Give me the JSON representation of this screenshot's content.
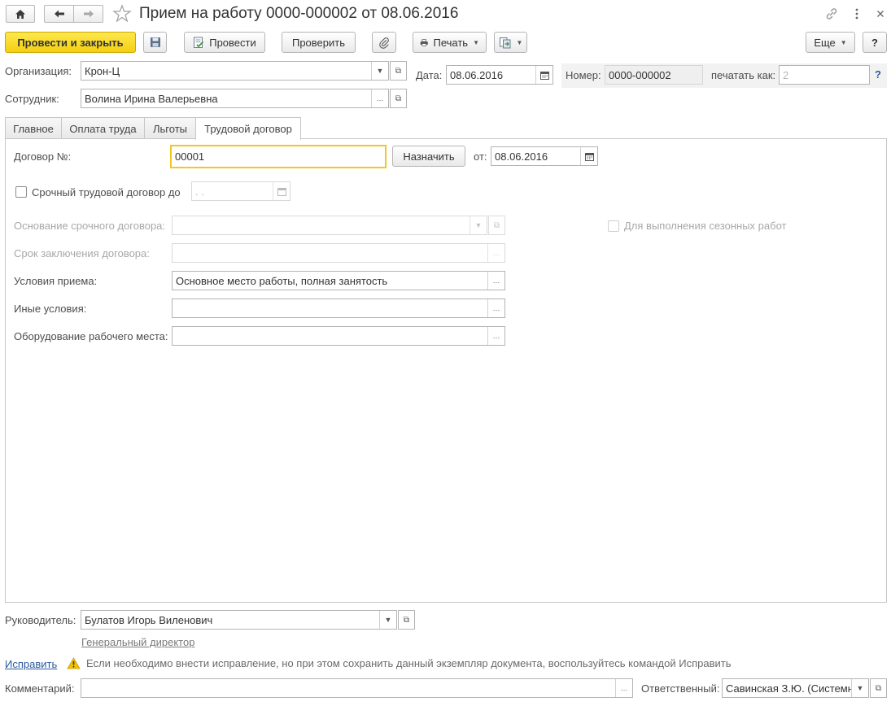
{
  "window": {
    "title": "Прием на работу 0000-000002 от 08.06.2016",
    "icons": [
      "home-icon",
      "back-arrow-icon",
      "forward-arrow-icon",
      "star-icon",
      "link-icon",
      "more-vertical-icon",
      "close-icon"
    ]
  },
  "toolbar": {
    "post_and_close": "Провести и закрыть",
    "post": "Провести",
    "check": "Проверить",
    "print": "Печать",
    "more": "Еще",
    "help": "?"
  },
  "header": {
    "organization_label": "Организация:",
    "organization_value": "Крон-Ц",
    "date_label": "Дата:",
    "date_value": "08.06.2016",
    "number_label": "Номер:",
    "number_value": "0000-000002",
    "print_as_label": "печатать как:",
    "print_as_placeholder": "2",
    "help_mark": "?",
    "employee_label": "Сотрудник:",
    "employee_value": "Волина Ирина Валерьевна"
  },
  "tabs": [
    {
      "label": "Главное",
      "active": false
    },
    {
      "label": "Оплата труда",
      "active": false
    },
    {
      "label": "Льготы",
      "active": false
    },
    {
      "label": "Трудовой договор",
      "active": true
    }
  ],
  "contract": {
    "number_label": "Договор №:",
    "number_value": "00001",
    "assign_button": "Назначить",
    "from_label": "от:",
    "from_date": "08.06.2016",
    "fixed_term_label": "Срочный трудовой договор до",
    "fixed_term_date": " .  .",
    "fixed_term_checked": false,
    "basis_label": "Основание срочного договора:",
    "basis_value": "",
    "seasonal_label": "Для выполнения сезонных работ",
    "seasonal_checked": false,
    "term_label": "Срок заключения договора:",
    "term_value": "",
    "conditions_label": "Условия приема:",
    "conditions_value": "Основное место работы, полная занятость",
    "other_label": "Иные условия:",
    "other_value": "",
    "equipment_label": "Оборудование рабочего места:",
    "equipment_value": ""
  },
  "footer": {
    "manager_label": "Руководитель:",
    "manager_value": "Булатов Игорь Виленович",
    "manager_position": "Генеральный директор",
    "fix_link": "Исправить",
    "fix_warning": "Если необходимо внести исправление, но при этом сохранить данный экземпляр документа, воспользуйтесь командой Исправить",
    "comment_label": "Комментарий:",
    "comment_value": "",
    "responsible_label": "Ответственный:",
    "responsible_value": "Савинская З.Ю. (Системный"
  },
  "colors": {
    "primary_button": "#f5cf10",
    "focus_border": "#f2c81f",
    "link": "#2a5b9e",
    "warning": "#e8b400"
  }
}
